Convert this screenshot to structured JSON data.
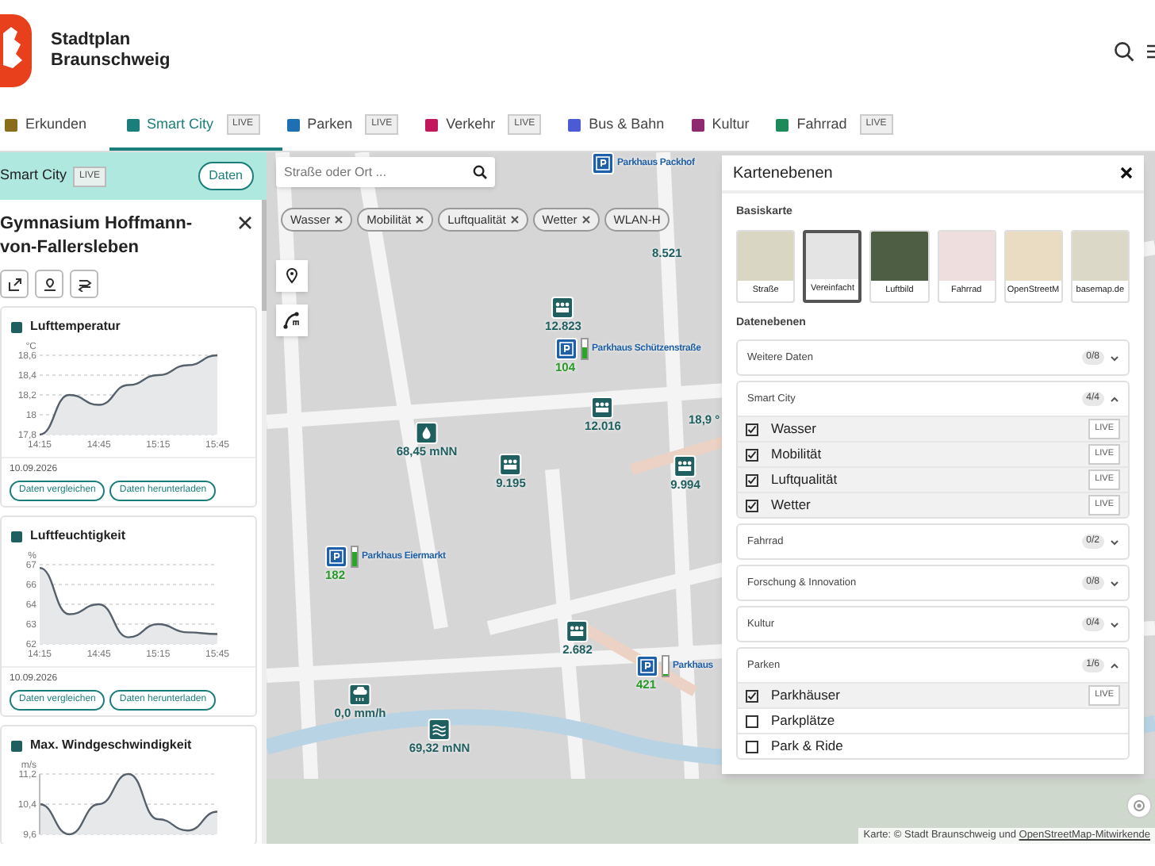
{
  "header": {
    "title_line_1": "Stadtplan",
    "title_line_2": "Braunschweig"
  },
  "tabs": [
    {
      "label": "Erkunden",
      "selected": false,
      "color": "#8a6d1a"
    },
    {
      "label": "Smart City",
      "selected": true,
      "color": "#1a7f7a",
      "badge": "LIVE"
    },
    {
      "label": "Parken",
      "selected": false,
      "color": "#1f6fb5",
      "badge": "LIVE"
    },
    {
      "label": "Verkehr",
      "selected": false,
      "color": "#c2185b",
      "badge": "LIVE"
    },
    {
      "label": "Bus & Bahn",
      "selected": false,
      "color": "#4a5bd4"
    },
    {
      "label": "Kultur",
      "selected": false,
      "color": "#8e2a6e"
    },
    {
      "label": "Fahrrad",
      "selected": false,
      "color": "#1e8a5a",
      "badge": "LIVE"
    }
  ],
  "sidebar": {
    "section": "Smart City",
    "badge": "LIVE",
    "data_button": "Daten",
    "title": "Gymnasium Hoffmann-von-Fallersleben",
    "cards": [
      {
        "title": "Lufttemperatur",
        "date": "10.09.2026",
        "buttons": [
          "Daten vergleichen",
          "Daten herunterladen"
        ],
        "chart_data": {
          "type": "area",
          "ylabel": "°C",
          "grid": true,
          "categories": [
            "14:15",
            null,
            "14:45",
            null,
            "15:15",
            null,
            "15:45"
          ],
          "values": [
            17.8,
            18.2,
            18.1,
            18.3,
            18.4,
            18.5,
            18.6
          ],
          "ylim": [
            17.8,
            18.6
          ],
          "yticks": [
            {
              "value": 17.8,
              "label": "17,8"
            },
            {
              "value": 18,
              "label": "18"
            },
            {
              "value": 18.2,
              "label": "18,2"
            },
            {
              "value": 18.4,
              "label": "18,4"
            },
            {
              "value": 18.6,
              "label": "18,6"
            }
          ]
        }
      },
      {
        "title": "Luftfeuchtigkeit",
        "date": "10.09.2026",
        "buttons": [
          "Daten vergleichen",
          "Daten herunterladen"
        ],
        "chart_data": {
          "type": "area",
          "ylabel": "%",
          "grid": true,
          "categories": [
            "14:15",
            null,
            "14:45",
            null,
            "15:15",
            null,
            "15:45"
          ],
          "values": [
            66.6,
            63.8,
            64.4,
            62.4,
            63.2,
            62.7,
            62.6
          ],
          "ylim": [
            62,
            66.8
          ],
          "yticks": [
            {
              "value": 62,
              "label": "62"
            },
            {
              "value": 63.2,
              "label": "63"
            },
            {
              "value": 64.4,
              "label": "64"
            },
            {
              "value": 65.6,
              "label": "66"
            },
            {
              "value": 66.8,
              "label": "67"
            }
          ]
        }
      },
      {
        "title": "Max. Windgeschwindigkeit",
        "chart_data": {
          "type": "area",
          "ylabel": "m/s",
          "grid": true,
          "values": [
            10.4,
            9.6,
            10.4,
            11.2,
            10.0,
            9.7,
            10.2
          ],
          "ylim": [
            9.6,
            11.2
          ],
          "yticks": [
            {
              "value": 9.6,
              "label": "9,6"
            },
            {
              "value": 10.4,
              "label": "10,4"
            },
            {
              "value": 11.2,
              "label": "11,2"
            }
          ]
        }
      }
    ]
  },
  "map": {
    "search": {
      "placeholder": "Straße oder Ort ..."
    },
    "chips": [
      "Wasser",
      "Mobilität",
      "Luftqualität",
      "Wetter",
      "WLAN-H"
    ],
    "markers": [
      {
        "kind": "parking",
        "label": "Parkhaus Packhof"
      },
      {
        "kind": "value",
        "value": "8.521"
      },
      {
        "kind": "people",
        "value": "12.823"
      },
      {
        "kind": "parking",
        "label": "Parkhaus Schützenstraße",
        "value": "104",
        "level": 0.55
      },
      {
        "kind": "people",
        "value": "12.016"
      },
      {
        "kind": "value",
        "value": "18,9 °"
      },
      {
        "kind": "water",
        "value": "68,45 mNN"
      },
      {
        "kind": "people",
        "value": "9.195"
      },
      {
        "kind": "people",
        "value": "9.994"
      },
      {
        "kind": "parking",
        "label": "Parkhaus Eiermarkt",
        "value": "182",
        "level": 0.75
      },
      {
        "kind": "people",
        "value": "2.682"
      },
      {
        "kind": "parking",
        "label": "Parkhaus",
        "value": "421",
        "level": 0.1
      },
      {
        "kind": "rain",
        "value": "0,0 mm/h"
      },
      {
        "kind": "river",
        "value": "69,32 mNN"
      }
    ],
    "attribution_prefix": "Karte: © Stadt Braunschweig und ",
    "attribution_link": "OpenStreetMap-Mitwirkende"
  },
  "layers_panel": {
    "title": "Kartenebenen",
    "base_heading": "Basiskarte",
    "base_maps": [
      {
        "label": "Straße",
        "selected": false
      },
      {
        "label": "Vereinfacht",
        "selected": true
      },
      {
        "label": "Luftbild",
        "selected": false
      },
      {
        "label": "Fahrrad",
        "selected": false
      },
      {
        "label": "OpenStreetM",
        "selected": false
      },
      {
        "label": "basemap.de",
        "selected": false
      }
    ],
    "data_heading": "Datenebenen",
    "groups": [
      {
        "name": "Weitere Daten",
        "count": "0/8",
        "expanded": false
      },
      {
        "name": "Smart City",
        "count": "4/4",
        "expanded": true,
        "items": [
          {
            "label": "Wasser",
            "checked": true,
            "badge": "LIVE"
          },
          {
            "label": "Mobilität",
            "checked": true,
            "badge": "LIVE"
          },
          {
            "label": "Luftqualität",
            "checked": true,
            "badge": "LIVE"
          },
          {
            "label": "Wetter",
            "checked": true,
            "badge": "LIVE"
          }
        ]
      },
      {
        "name": "Fahrrad",
        "count": "0/2",
        "expanded": false
      },
      {
        "name": "Forschung & Innovation",
        "count": "0/8",
        "expanded": false
      },
      {
        "name": "Kultur",
        "count": "0/4",
        "expanded": false
      },
      {
        "name": "Parken",
        "count": "1/6",
        "expanded": true,
        "items": [
          {
            "label": "Parkhäuser",
            "checked": true,
            "badge": "LIVE"
          },
          {
            "label": "Parkplätze",
            "checked": false
          },
          {
            "label": "Park & Ride",
            "checked": false
          }
        ]
      }
    ]
  }
}
